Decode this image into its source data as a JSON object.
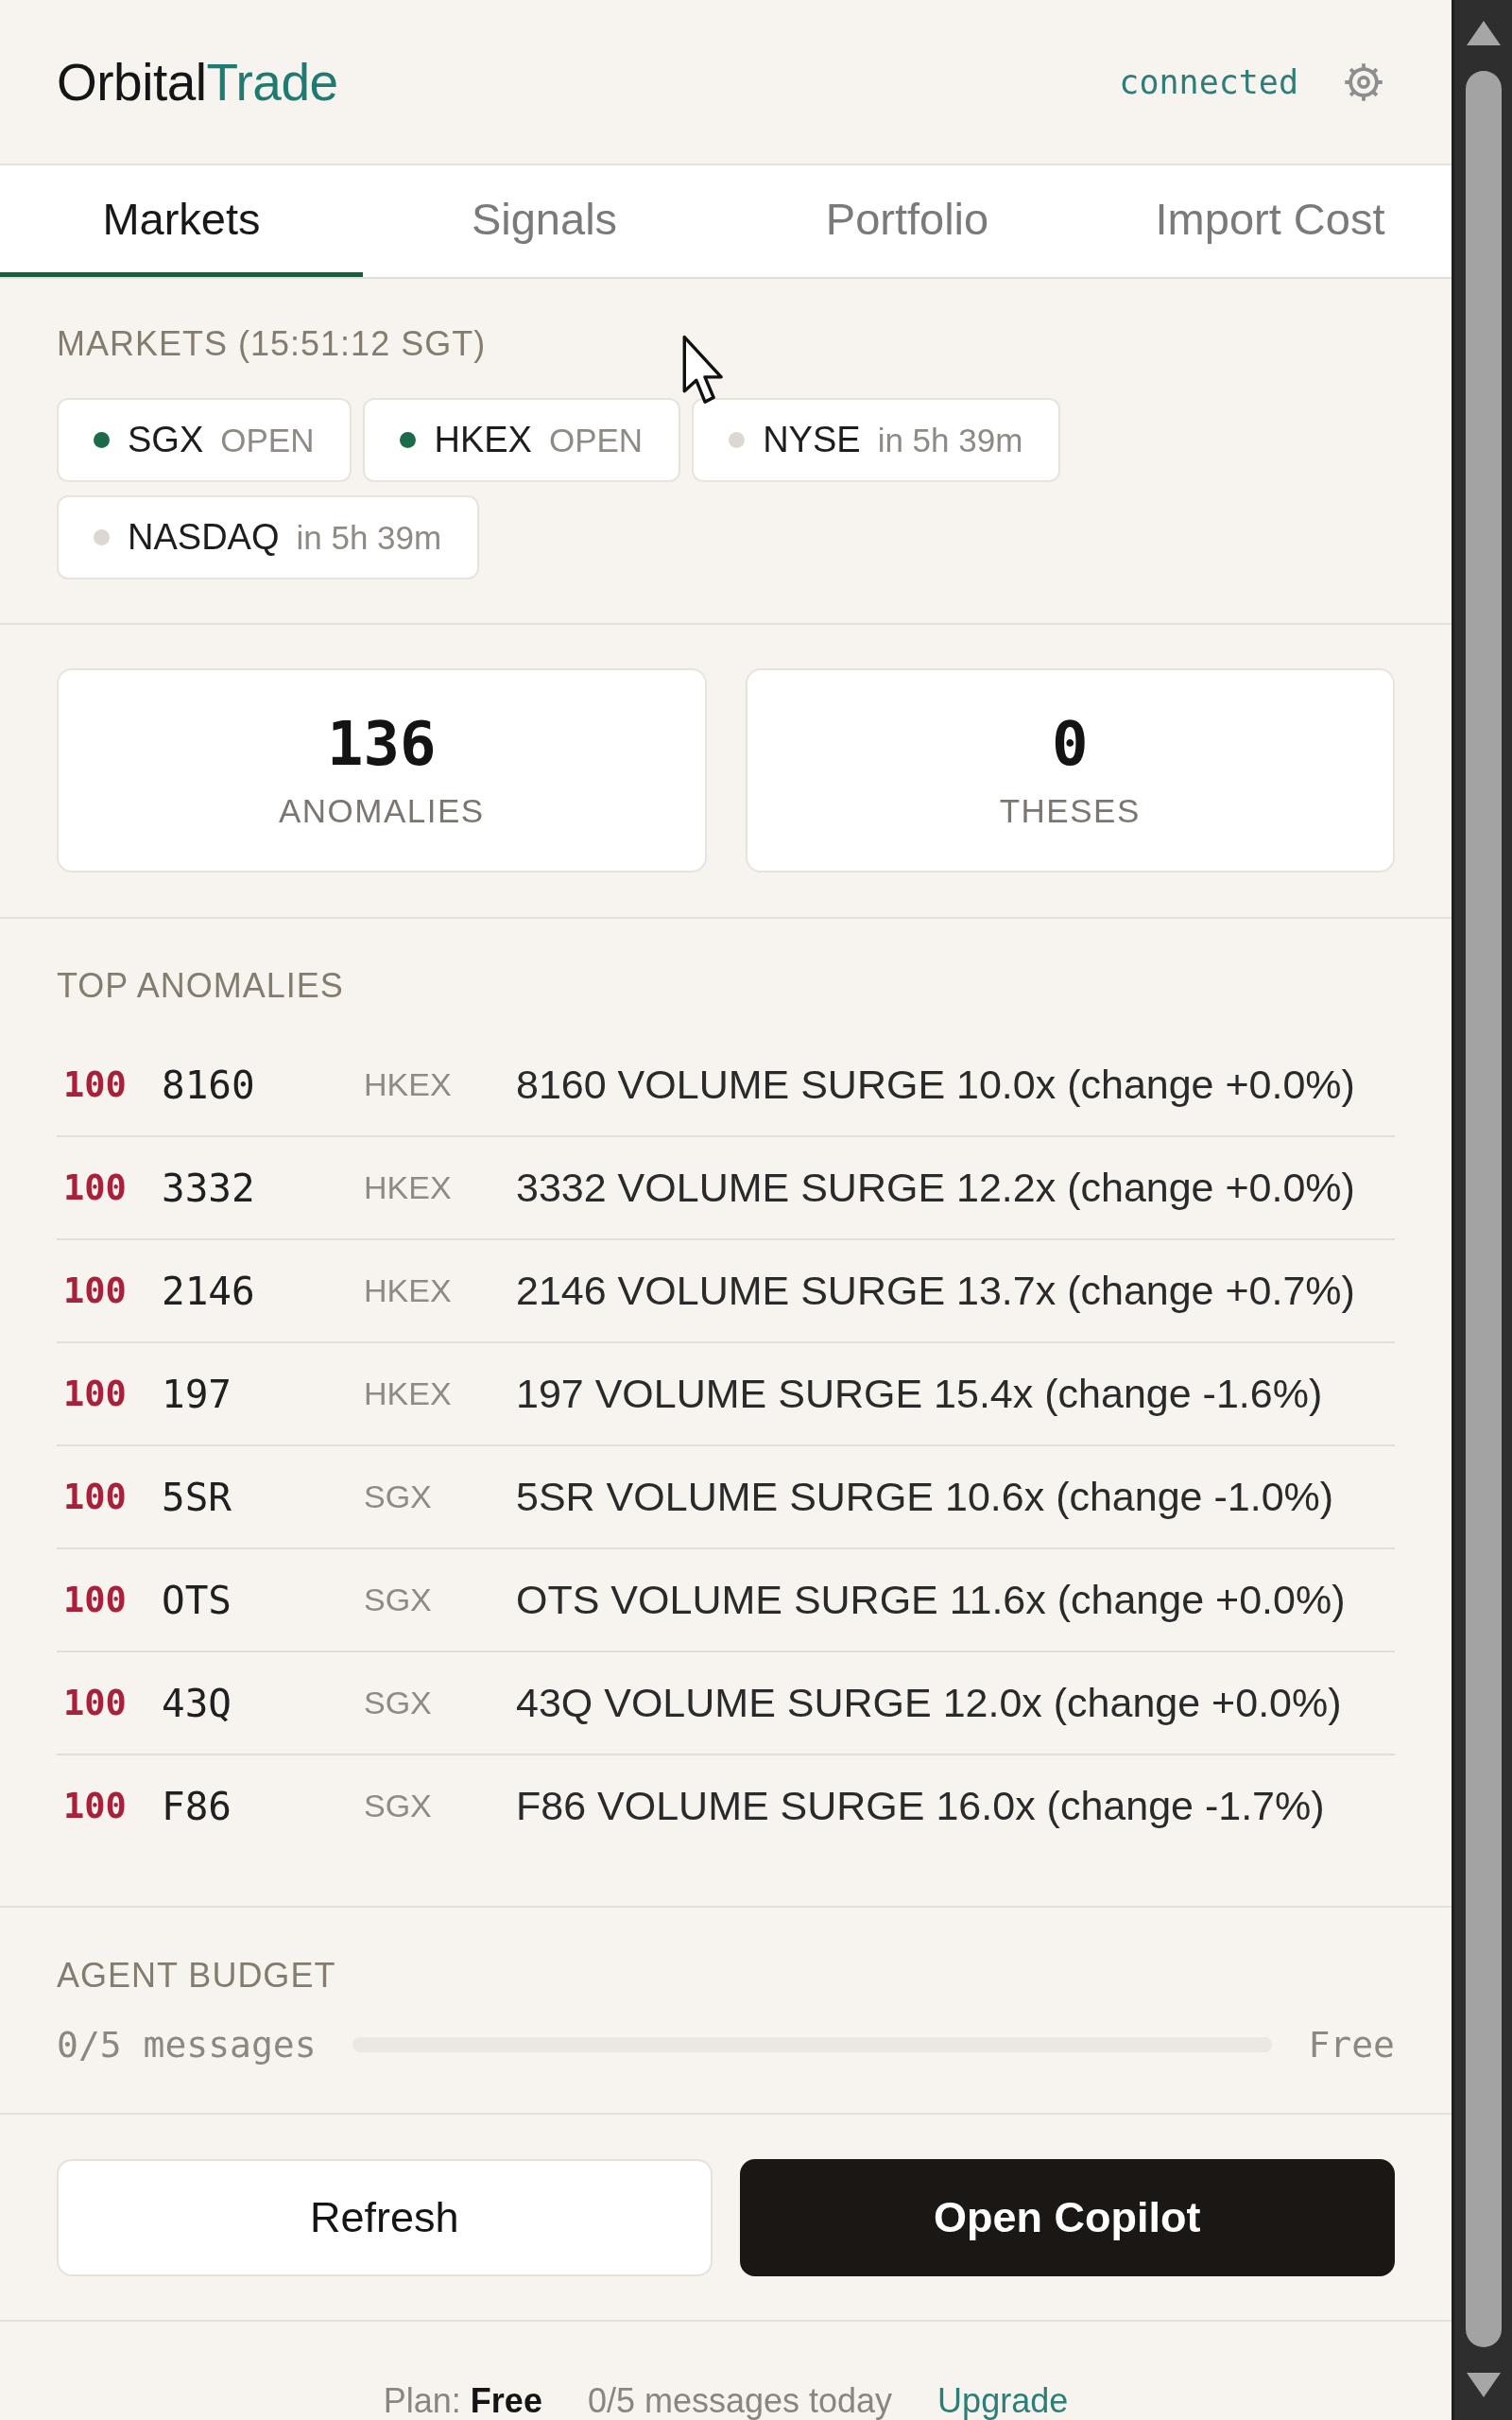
{
  "header": {
    "logo": {
      "text": "Orbital",
      "accent": "Trade"
    },
    "status": "connected"
  },
  "tabs": [
    {
      "label": "Markets",
      "selected": true
    },
    {
      "label": "Signals",
      "selected": false
    },
    {
      "label": "Portfolio",
      "selected": false
    },
    {
      "label": "Import Cost",
      "selected": false
    }
  ],
  "markets": {
    "title": "MARKETS (15:51:12 SGT)",
    "exchanges": [
      {
        "name": "SGX",
        "status": "OPEN",
        "color": "#1d6a4a"
      },
      {
        "name": "HKEX",
        "status": "OPEN",
        "color": "#1d6a4a"
      },
      {
        "name": "NYSE",
        "status": "in 5h 39m",
        "color": "#dcd8d1"
      },
      {
        "name": "NASDAQ",
        "status": "in 5h 39m",
        "color": "#dcd8d1"
      }
    ]
  },
  "stats": [
    {
      "value": "136",
      "label": "ANOMALIES"
    },
    {
      "value": "0",
      "label": "THESES"
    }
  ],
  "top_anomalies": {
    "title": "TOP ANOMALIES",
    "rows": [
      {
        "score": "100",
        "symbol": "8160",
        "exchange": "HKEX",
        "description": "8160 VOLUME SURGE 10.0x (change +0.0%)"
      },
      {
        "score": "100",
        "symbol": "3332",
        "exchange": "HKEX",
        "description": "3332 VOLUME SURGE 12.2x (change +0.0%)"
      },
      {
        "score": "100",
        "symbol": "2146",
        "exchange": "HKEX",
        "description": "2146 VOLUME SURGE 13.7x (change +0.7%)"
      },
      {
        "score": "100",
        "symbol": "197",
        "exchange": "HKEX",
        "description": "197 VOLUME SURGE 15.4x (change -1.6%)"
      },
      {
        "score": "100",
        "symbol": "5SR",
        "exchange": "SGX",
        "description": "5SR VOLUME SURGE 10.6x (change -1.0%)"
      },
      {
        "score": "100",
        "symbol": "OTS",
        "exchange": "SGX",
        "description": "OTS VOLUME SURGE 11.6x (change +0.0%)"
      },
      {
        "score": "100",
        "symbol": "43Q",
        "exchange": "SGX",
        "description": "43Q VOLUME SURGE 12.0x (change +0.0%)"
      },
      {
        "score": "100",
        "symbol": "F86",
        "exchange": "SGX",
        "description": "F86 VOLUME SURGE 16.0x (change -1.7%)"
      }
    ]
  },
  "agent_budget": {
    "title": "AGENT BUDGET",
    "usage": "0/5 messages",
    "level": 0,
    "plan": "Free"
  },
  "actions": [
    {
      "label": "Refresh",
      "kind": "secondary"
    },
    {
      "label": "Open Copilot",
      "kind": "primary"
    }
  ],
  "footer": {
    "plan": "Plan: **Free**",
    "usage": "0/5 messages today",
    "link": "Upgrade"
  }
}
